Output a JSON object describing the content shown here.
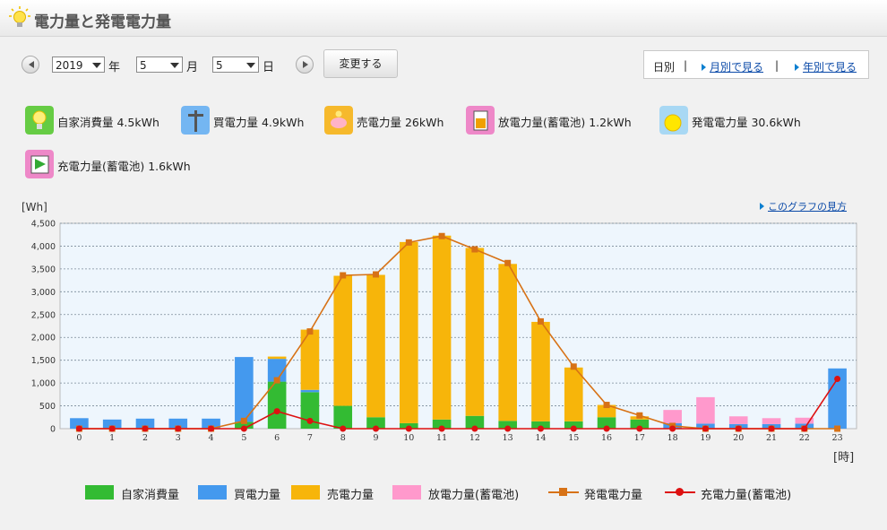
{
  "header": {
    "title": "電力量と発電電力量"
  },
  "controls": {
    "year": "2019",
    "year_unit": "年",
    "month": "5",
    "month_unit": "月",
    "day": "5",
    "day_unit": "日",
    "change_label": "変更する",
    "view_current": "日別",
    "view_month": "月別で見る",
    "view_year": "年別で見る"
  },
  "summary": {
    "self": "自家消費量 4.5kWh",
    "buy": "買電力量 4.9kWh",
    "sell": "売電力量 26kWh",
    "discharge": "放電力量(蓄電池) 1.2kWh",
    "gen": "発電電力量 30.6kWh",
    "charge": "充電力量(蓄電池) 1.6kWh"
  },
  "howto": "このグラフの見方",
  "colors": {
    "self": "#33bb33",
    "buy": "#4499ee",
    "sell": "#f7b50a",
    "discharge": "#ff99cc",
    "gen": "#d77216",
    "charge": "#dd1111",
    "plotbg": "#eef6fd"
  },
  "chart_data": {
    "type": "bar",
    "stacked": true,
    "ylabel": "[Wh]",
    "xlabel": "[時]",
    "ylim": [
      0,
      4500
    ],
    "yticks": [
      "0",
      "500",
      "1,000",
      "1,500",
      "2,000",
      "2,500",
      "3,000",
      "3,500",
      "4,000",
      "4,500"
    ],
    "categories": [
      "0",
      "1",
      "2",
      "3",
      "4",
      "5",
      "6",
      "7",
      "8",
      "9",
      "10",
      "11",
      "12",
      "13",
      "14",
      "15",
      "16",
      "17",
      "18",
      "19",
      "20",
      "21",
      "22",
      "23"
    ],
    "series": [
      {
        "name": "自家消費量",
        "kind": "bar",
        "values": [
          0,
          0,
          0,
          0,
          0,
          150,
          1030,
          800,
          500,
          250,
          120,
          200,
          280,
          170,
          160,
          160,
          250,
          200,
          0,
          0,
          0,
          0,
          0,
          0
        ]
      },
      {
        "name": "買電力量",
        "kind": "bar",
        "values": [
          230,
          200,
          220,
          220,
          220,
          1420,
          500,
          50,
          0,
          0,
          0,
          0,
          0,
          0,
          0,
          0,
          0,
          0,
          120,
          110,
          100,
          100,
          110,
          1320
        ]
      },
      {
        "name": "売電力量",
        "kind": "bar",
        "values": [
          0,
          0,
          0,
          0,
          0,
          0,
          50,
          1320,
          2850,
          3120,
          3970,
          4030,
          3680,
          3440,
          2180,
          1180,
          270,
          70,
          0,
          0,
          0,
          0,
          0,
          0
        ]
      },
      {
        "name": "放電力量(蓄電池)",
        "kind": "bar",
        "values": [
          0,
          0,
          0,
          0,
          0,
          0,
          0,
          0,
          0,
          0,
          0,
          0,
          0,
          0,
          0,
          0,
          0,
          0,
          290,
          580,
          170,
          130,
          130,
          0
        ]
      },
      {
        "name": "発電電力量",
        "kind": "line",
        "values": [
          0,
          0,
          0,
          0,
          0,
          170,
          1060,
          2130,
          3360,
          3380,
          4080,
          4220,
          3930,
          3630,
          2350,
          1360,
          520,
          290,
          60,
          0,
          0,
          0,
          0,
          0
        ]
      },
      {
        "name": "充電力量(蓄電池)",
        "kind": "line",
        "values": [
          0,
          0,
          0,
          0,
          0,
          0,
          380,
          170,
          0,
          0,
          0,
          0,
          0,
          0,
          0,
          0,
          0,
          0,
          0,
          0,
          0,
          0,
          0,
          1090
        ]
      }
    ]
  }
}
